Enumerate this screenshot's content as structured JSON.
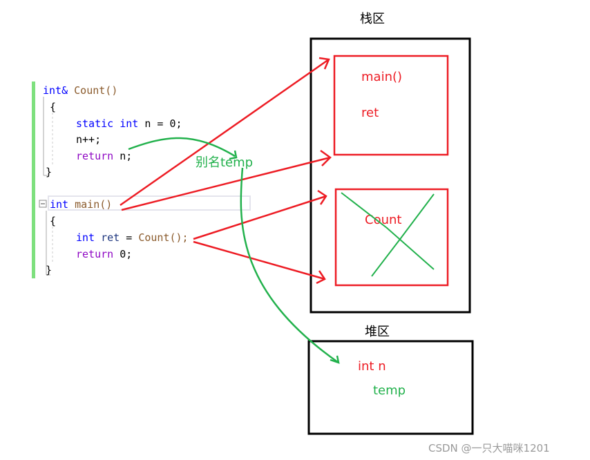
{
  "code": {
    "line1": {
      "kw": "int&",
      "fn": "Count()"
    },
    "line2": "{",
    "line3": {
      "kw1": "static",
      "kw2": "int",
      "rest": "n = 0;"
    },
    "line4": "n++;",
    "line5": {
      "kw": "return",
      "rest": "n;"
    },
    "line6": "}",
    "line7": {
      "kw": "int",
      "fn": "main()"
    },
    "line8": "{",
    "line9": {
      "kw": "int",
      "id": "ret",
      "eq": "=",
      "fn": "Count();"
    },
    "line10": {
      "kw": "return",
      "rest": "0;"
    },
    "line11": "}"
  },
  "stack": {
    "title": "栈区",
    "main_frame": {
      "name": "main()",
      "var": "ret"
    },
    "count_frame": {
      "name": "Count"
    }
  },
  "heap": {
    "title": "堆区",
    "var": "int n",
    "alias": "temp"
  },
  "alias_label": "别名temp",
  "watermark": "CSDN @一只大喵咪1201",
  "colors": {
    "red": "#ed1c24",
    "green": "#22b14c",
    "editor_bar": "#7ee07e"
  }
}
